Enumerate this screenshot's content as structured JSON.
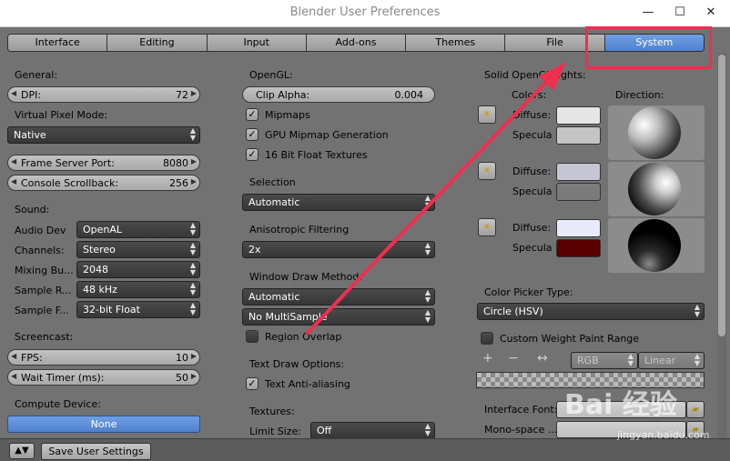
{
  "window": {
    "title": "Blender User Preferences",
    "minimize": "—",
    "maximize": "☐",
    "close": "✕"
  },
  "tabs": [
    {
      "label": "Interface"
    },
    {
      "label": "Editing"
    },
    {
      "label": "Input"
    },
    {
      "label": "Add-ons"
    },
    {
      "label": "Themes"
    },
    {
      "label": "File"
    },
    {
      "label": "System",
      "active": true
    }
  ],
  "col1": {
    "general_label": "General:",
    "dpi": {
      "label": "DPI:",
      "value": "72"
    },
    "virtual_pixel_label": "Virtual Pixel Mode:",
    "virtual_pixel_value": "Native",
    "frame_server": {
      "label": "Frame Server Port:",
      "value": "8080"
    },
    "console_scroll": {
      "label": "Console Scrollback:",
      "value": "256"
    },
    "sound_label": "Sound:",
    "audio_dev": {
      "label": "Audio Dev",
      "value": "OpenAL"
    },
    "channels": {
      "label": "Channels:",
      "value": "Stereo"
    },
    "mixing": {
      "label": "Mixing Bu...",
      "value": "2048"
    },
    "sample_rate": {
      "label": "Sample R...",
      "value": "48 kHz"
    },
    "sample_format": {
      "label": "Sample F...",
      "value": "32-bit Float"
    },
    "screencast_label": "Screencast:",
    "fps": {
      "label": "FPS:",
      "value": "10"
    },
    "wait_timer": {
      "label": "Wait Timer (ms):",
      "value": "50"
    },
    "compute_label": "Compute Device:",
    "compute_value": "None"
  },
  "col2": {
    "opengl_label": "OpenGL:",
    "clip_alpha": {
      "label": "Clip Alpha:",
      "value": "0.004"
    },
    "mipmaps": "Mipmaps",
    "gpu_mipmap": "GPU Mipmap Generation",
    "float_textures": "16 Bit Float Textures",
    "selection_label": "Selection",
    "selection_value": "Automatic",
    "aniso_label": "Anisotropic Filtering",
    "aniso_value": "2x",
    "window_draw_label": "Window Draw Method:",
    "window_draw_value": "Automatic",
    "multisample_value": "No MultiSample",
    "region_overlap": "Region Overlap",
    "text_draw_label": "Text Draw Options:",
    "text_antialias": "Text Anti-aliasing",
    "textures_label": "Textures:",
    "limit_size_label": "Limit Size:",
    "limit_size_value": "Off"
  },
  "col3": {
    "solid_lights_label": "Solid OpenGL lights:",
    "colors_label": "Colors:",
    "direction_label": "Direction:",
    "diffuse_label": "Diffuse:",
    "specular_label": "Specula",
    "lights": [
      {
        "diffuse": "#e6e6e6",
        "specular": "#c4c4c4"
      },
      {
        "diffuse": "#c5c5d3",
        "specular": "#7b7b7b"
      },
      {
        "diffuse": "#e8eafa",
        "specular": "#5a0000"
      }
    ],
    "color_picker_label": "Color Picker Type:",
    "color_picker_value": "Circle (HSV)",
    "weight_paint": "Custom Weight Paint Range",
    "plus": "+",
    "minus": "−",
    "swap": "↔",
    "rgb_value": "RGB",
    "linear_value": "Linear",
    "interface_font_label": "Interface Font:",
    "mono_font_label": "Mono-space ..."
  },
  "footer": {
    "save_label": "Save User Settings"
  },
  "watermark": {
    "brand": "Bai 经验",
    "url": "jingyan.baidu.com"
  },
  "icons": {
    "bulb": "☀",
    "folder": "▰",
    "check": "✓",
    "updown": "▲▼"
  }
}
